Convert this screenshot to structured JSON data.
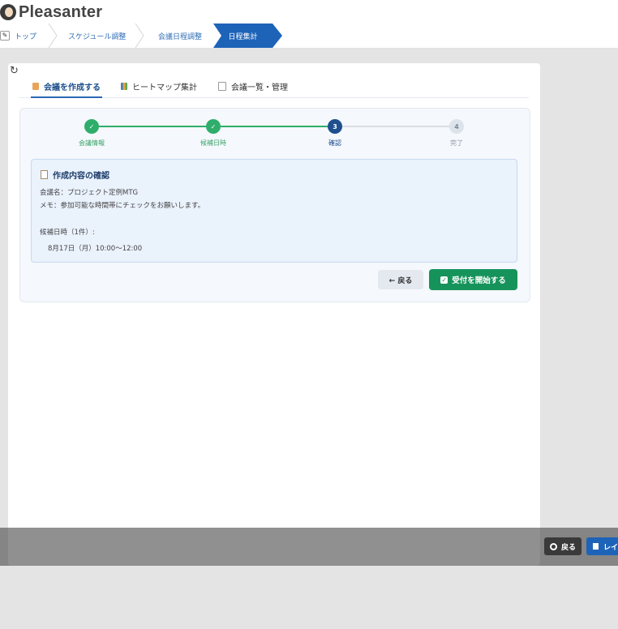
{
  "header": {
    "app_name": "Pleasanter"
  },
  "breadcrumb": {
    "items": [
      "トップ",
      "スケジュール調整",
      "会議日程調整"
    ],
    "active": "日程集計"
  },
  "tabs": [
    {
      "label": "会議を作成する",
      "icon": "document-pencil-icon"
    },
    {
      "label": "ヒートマップ集計",
      "icon": "chart-icon"
    },
    {
      "label": "会議一覧・管理",
      "icon": "list-icon"
    }
  ],
  "stepper": {
    "steps": [
      {
        "number": "✓",
        "label": "会議情報",
        "state": "done"
      },
      {
        "number": "✓",
        "label": "候補日時",
        "state": "done"
      },
      {
        "number": "3",
        "label": "確認",
        "state": "current"
      },
      {
        "number": "4",
        "label": "完了",
        "state": "pending"
      }
    ]
  },
  "confirm": {
    "title": "作成内容の確認",
    "meeting_name": "会議名：プロジェクト定例MTG",
    "memo": "メモ：参加可能な時間帯にチェックをお願いします。",
    "candidates_heading": "候補日時（1件）:",
    "candidates": [
      "8月17日（月）10:00〜12:00"
    ]
  },
  "actions": {
    "back_label": "← 戻る",
    "start_label": "受付を開始する"
  },
  "footer": {
    "back_label": "戻る",
    "layout_label": "レイ"
  },
  "colors": {
    "primary": "#1d63b8",
    "success": "#16935b",
    "step_done": "#2eae6a",
    "step_current": "#1f4f8f"
  }
}
